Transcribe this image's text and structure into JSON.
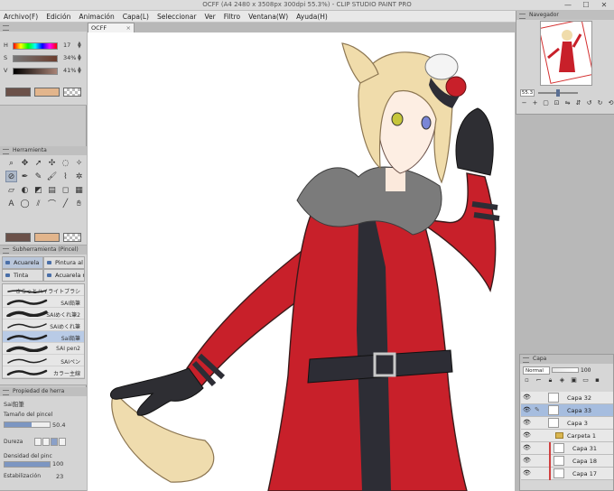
{
  "window": {
    "title": "OCFF (A4 2480 x 3508px 300dpi 55.3%) - CLIP STUDIO PAINT PRO",
    "controls": [
      "—",
      "☐",
      "✕"
    ]
  },
  "menu": [
    "Archivo(F)",
    "Edición",
    "Animación",
    "Capa(L)",
    "Seleccionar",
    "Ver",
    "Filtro",
    "Ventana(W)",
    "Ayuda(H)"
  ],
  "color_panel": {
    "rows": [
      {
        "label": "H",
        "value": "17"
      },
      {
        "label": "S",
        "value": "34%"
      },
      {
        "label": "V",
        "value": "41%"
      }
    ],
    "main_color": "#6b5149",
    "sub_color": "#e2b58c"
  },
  "tool_panel": {
    "title": "Herramienta",
    "tools": [
      "zoom-icon",
      "move-icon",
      "operation-icon",
      "move-layer-icon",
      "lasso-icon",
      "magic-wand-icon",
      "eyedropper-icon",
      "pen-icon",
      "pencil-icon",
      "brush-icon",
      "airbrush-icon",
      "decoration-icon",
      "eraser-icon",
      "blend-icon",
      "fill-icon",
      "gradient-icon",
      "figure-icon",
      "frame-icon",
      "text-icon",
      "balloon-icon",
      "ruler-icon",
      "correct-line-icon",
      "line-icon",
      "hand-icon"
    ],
    "active_index": 6,
    "main_color": "#6b5149",
    "sub_color": "#e2b58c"
  },
  "subtool_panel": {
    "title": "Subherramienta (Pincel)",
    "tabs": [
      "Acuarela",
      "Pintura al ó",
      "Tinta",
      "Acuarela re"
    ],
    "active_tab": 0,
    "brushes": [
      "さらっとハイライトブラシ",
      "SAI鉛筆",
      "SAIめくれ筆2",
      "SAIめくれ筆",
      "Sai鉛筆",
      "SAI pen2",
      "SAIペン",
      "カラー主線"
    ],
    "selected_index": 4
  },
  "property_panel": {
    "title": "Propiedad de herra",
    "brush_name": "Sai鉛筆",
    "size_label": "Tamaño del pincel",
    "size_value": "50.4",
    "hardness_label": "Dureza",
    "density_label": "Densidad del pinc",
    "density_value": "100",
    "stabilization_label": "Estabilización",
    "stabilization_value": "23"
  },
  "document_tab": {
    "label": "OCFF",
    "close": "×"
  },
  "navigator": {
    "title": "Navegador",
    "zoom": "55.3",
    "buttons": [
      "zoom-out",
      "zoom-in",
      "fit",
      "actual",
      "flip-h",
      "flip-v",
      "rotate-left",
      "rotate-right",
      "reset"
    ]
  },
  "layer_panel": {
    "title": "Capa",
    "blend_mode": "Normal",
    "opacity": "100",
    "layers": [
      {
        "name": "Capa 32",
        "type": "raster",
        "selected": false,
        "clipped": false,
        "indent": 0
      },
      {
        "name": "Capa 33",
        "type": "raster",
        "selected": true,
        "clipped": false,
        "indent": 0
      },
      {
        "name": "Capa 3",
        "type": "raster",
        "selected": false,
        "clipped": false,
        "indent": 0
      },
      {
        "name": "Carpeta 1",
        "type": "folder",
        "selected": false,
        "clipped": false,
        "indent": 0
      },
      {
        "name": "Capa 31",
        "type": "raster",
        "selected": false,
        "clipped": true,
        "indent": 1
      },
      {
        "name": "Capa 18",
        "type": "raster",
        "selected": false,
        "clipped": true,
        "indent": 1
      },
      {
        "name": "Capa 17",
        "type": "raster",
        "selected": false,
        "clipped": true,
        "indent": 1
      }
    ]
  },
  "colors": {
    "selection": "#a6bddf",
    "coat_red": "#c8202a",
    "hair": "#f0dcab"
  }
}
